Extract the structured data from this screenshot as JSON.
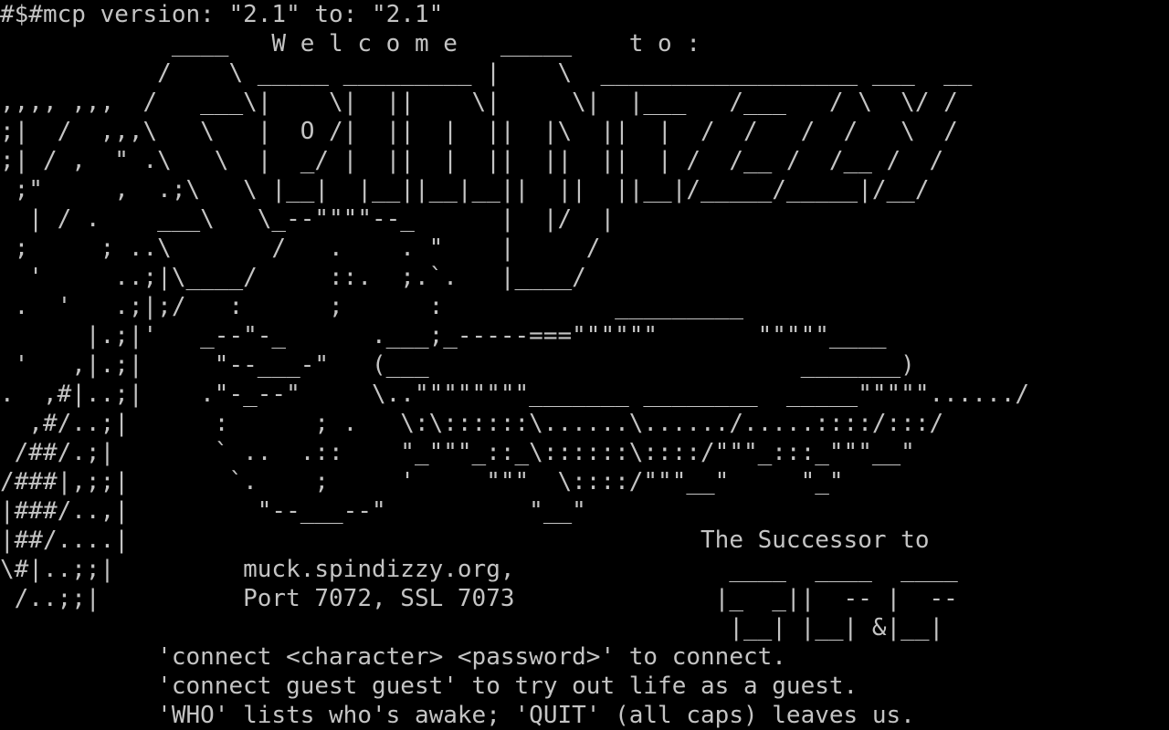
{
  "terminal": {
    "background": "#000000",
    "foreground": "#c4c4c4",
    "lines": [
      "#$#mcp version: \"2.1\" to: \"2.1\"",
      "            ____   W e l c o m e   _____    t o :",
      "           /    \\ _____ _________ |    \\  __________________ ___  __",
      ",,,, ,,,  /   ___\\|    \\|  ||    \\|     \\|  |___   /___   / \\  \\/ /",
      ";|  /  ,,,\\   \\   |  O /|  ||  |  ||  |\\  ||  |  /  /   /  /   \\  /",
      ";| / ,  \" .\\   \\  |  _/ |  ||  |  ||  ||  ||  | /  /__ /  /__ /  /",
      " ;\"     ,  .;\\   \\ |__|  |__||__|__||  ||  ||__|/_____/_____|/__/",
      "  | / .    ___\\   \\_--\"\"\"\"--_      |  |/  |",
      " ;     ; ..\\       /   .    . \"    |     /",
      "  '     ..;|\\____/     ::.  ;.`.   |____/",
      " .  '   .;|;/   :      ;      :            _________",
      "      |.;|'   _--\"-_      .___;_-----===\"\"\"\"\"\"       \"\"\"\"\"____",
      " '   ,|.;|     \"--___-\"   (___                          _______)",
      ".  ,#|..;|    .\"-_--\"     \\..\"\"\"\"\"\"\"\"_______ ________  _____\"\"\"\"\"....../",
      "  ,#/..;|      :      ; .   \\:\\::::::\\......\\....../.....::::/:::/",
      " /##/.;|       ` ..  .::    \"_\"\"\"_::_\\::::::\\::::/\"\"\"_:::_\"\"\"__\"",
      "/###|,;;|       `.    ;     '     \"\"\"  \\::::/\"\"\"__\"     \"_\"",
      "|###/..,|         \"--___--\"          \"__\"",
      "|##/....|                                        The Successor to",
      "\\#|..;;|         muck.spindizzy.org,               ____  ____  ____",
      " /..;;|          Port 7072, SSL 7073              |_  _||  -- |  --",
      "                                                   |__| |__| &|__|",
      "           'connect <character> <password>' to connect.",
      "           'connect guest guest' to try out life as a guest.",
      "           'WHO' lists who's awake; 'QUIT' (all caps) leaves us."
    ]
  }
}
